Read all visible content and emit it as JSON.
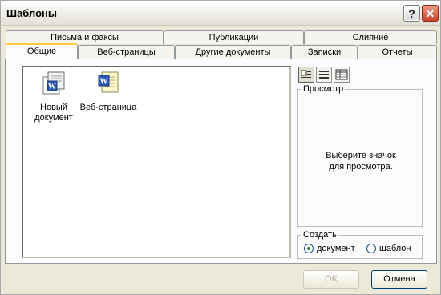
{
  "window": {
    "title": "Шаблоны",
    "help_label": "?",
    "close_label": "✕"
  },
  "tabs_back": [
    {
      "label": "Письма и факсы"
    },
    {
      "label": "Публикации"
    },
    {
      "label": "Слияние"
    }
  ],
  "tabs_front": [
    {
      "label": "Общие",
      "active": true
    },
    {
      "label": "Веб-страницы"
    },
    {
      "label": "Другие документы"
    },
    {
      "label": "Записки"
    },
    {
      "label": "Отчеты"
    }
  ],
  "templates": [
    {
      "label": "Новый документ",
      "icon": "new-document-icon"
    },
    {
      "label": "Веб-страница",
      "icon": "web-page-icon"
    }
  ],
  "view_buttons": [
    {
      "icon": "large-icons-view-icon",
      "pressed": true
    },
    {
      "icon": "list-view-icon"
    },
    {
      "icon": "details-view-icon"
    }
  ],
  "preview": {
    "label": "Просмотр",
    "message_line1": "Выберите значок",
    "message_line2": "для просмотра."
  },
  "create": {
    "label": "Создать",
    "options": [
      "документ",
      "шаблон"
    ],
    "selected": "документ"
  },
  "buttons": {
    "ok": "OK",
    "cancel": "Отмена"
  },
  "colors": {
    "tab_highlight": "#ffc83c",
    "radio_dot": "#2a8a2a",
    "close": "#c8452b"
  }
}
